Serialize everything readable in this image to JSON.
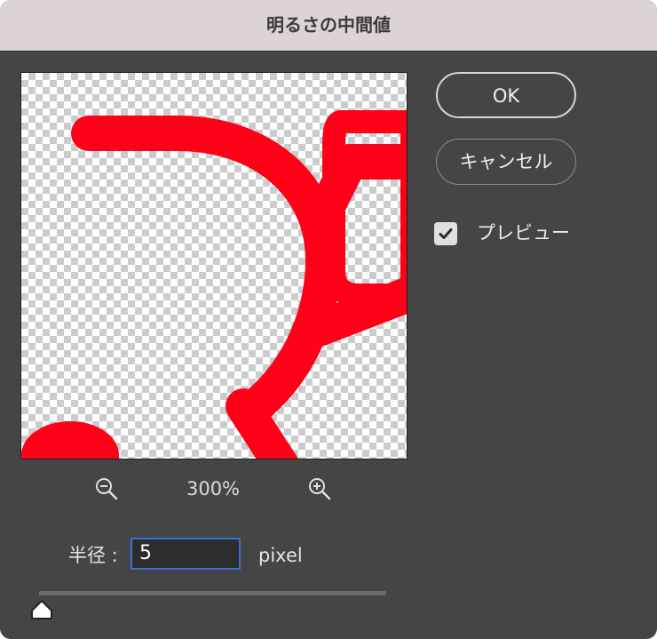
{
  "dialog": {
    "title": "明るさの中間値"
  },
  "preview_pane": {
    "zoom_level": "300%",
    "zoom_out_icon": "zoom-out-icon",
    "zoom_in_icon": "zoom-in-icon",
    "shape_color": "#ff0018"
  },
  "buttons": {
    "ok_label": "OK",
    "cancel_label": "キャンセル"
  },
  "preview_toggle": {
    "label": "プレビュー",
    "checked": true
  },
  "radius": {
    "label": "半径 :",
    "value": "5",
    "unit": "pixel",
    "slider_fraction": 0
  },
  "colors": {
    "accent": "#3b6fd4",
    "panel": "#454545",
    "titlebar": "#dcd3d6"
  }
}
